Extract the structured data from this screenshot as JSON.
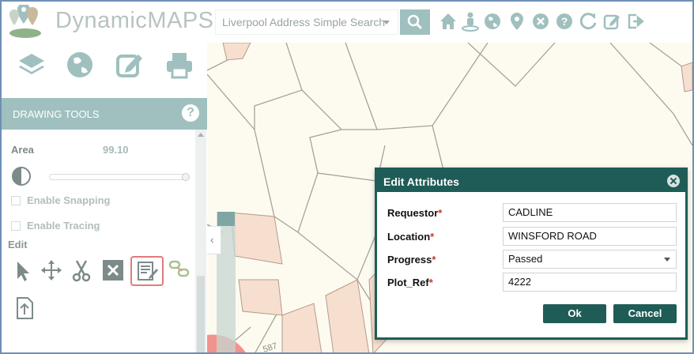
{
  "header": {
    "brand_prefix": "Dynamic",
    "brand_suffix": "MAPS",
    "search_select": "Liverpool Address Simple Search",
    "toolbar_icons": [
      "home-icon",
      "street-view-icon",
      "globe-icon",
      "map-marker-icon",
      "close-circle-icon",
      "help-icon",
      "refresh-icon",
      "edit-icon",
      "logout-icon"
    ]
  },
  "left_panel": {
    "top_icons": [
      "layers-icon",
      "globe-icon",
      "edit-icon",
      "print-icon"
    ],
    "section_title": "DRAWING TOOLS",
    "help_glyph": "?",
    "area_label": "Area",
    "area_value": "99.10",
    "snapping_label": "Enable Snapping",
    "tracing_label": "Enable Tracing",
    "edit_label": "Edit",
    "edit_tools": [
      "select-arrow-icon",
      "move-icon",
      "cut-icon",
      "delete-icon",
      "edit-attributes-icon",
      "link-icon"
    ],
    "export_icon": "upload-file-icon"
  },
  "map": {
    "collapse_glyph": "‹",
    "header_collapse_glyph": "‹"
  },
  "dialog": {
    "title": "Edit Attributes",
    "fields": [
      {
        "label": "Requestor",
        "required": "*",
        "value": "CADLINE"
      },
      {
        "label": "Location",
        "required": "*",
        "value": "WINSFORD ROAD"
      },
      {
        "label": "Progress",
        "required": "*",
        "value": "Passed"
      },
      {
        "label": "Plot_Ref",
        "required": "*",
        "value": "4222"
      }
    ],
    "ok_label": "Ok",
    "cancel_label": "Cancel"
  },
  "colors": {
    "accent": "#9fc0bf",
    "dialog": "#1f5c57",
    "required": "#d2332b"
  }
}
